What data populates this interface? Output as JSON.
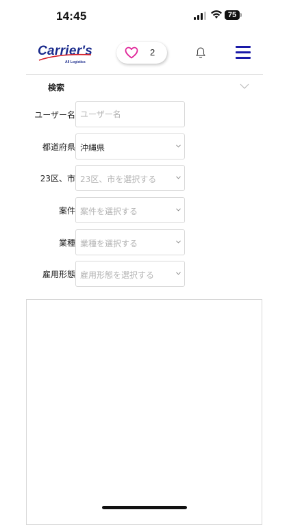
{
  "status_bar": {
    "time": "14:45",
    "battery": "75",
    "icons": [
      "signal-icon",
      "wifi-icon",
      "battery-icon"
    ]
  },
  "header": {
    "logo_text": "Carrier's",
    "logo_subtext": "All Logistics",
    "favorite_count": "2",
    "icons": [
      "heart-icon",
      "bell-icon",
      "menu-icon"
    ],
    "colors": {
      "brand": "#1a2b8c",
      "heart": "#e0269a",
      "menu": "#1a1aa8"
    }
  },
  "search": {
    "title": "検索",
    "fields": [
      {
        "label": "ユーザー名",
        "value": "",
        "placeholder": "ユーザー名",
        "type": "text"
      },
      {
        "label": "都道府県",
        "value": "沖縄県",
        "placeholder": "",
        "type": "select"
      },
      {
        "label": "23区、市",
        "value": "",
        "placeholder": "23区、市を選択する",
        "type": "select"
      },
      {
        "label": "案件",
        "value": "",
        "placeholder": "案件を選択する",
        "type": "select"
      },
      {
        "label": "業種",
        "value": "",
        "placeholder": "業種を選択する",
        "type": "select"
      },
      {
        "label": "雇用形態",
        "value": "",
        "placeholder": "雇用形態を選択する",
        "type": "select"
      }
    ]
  }
}
